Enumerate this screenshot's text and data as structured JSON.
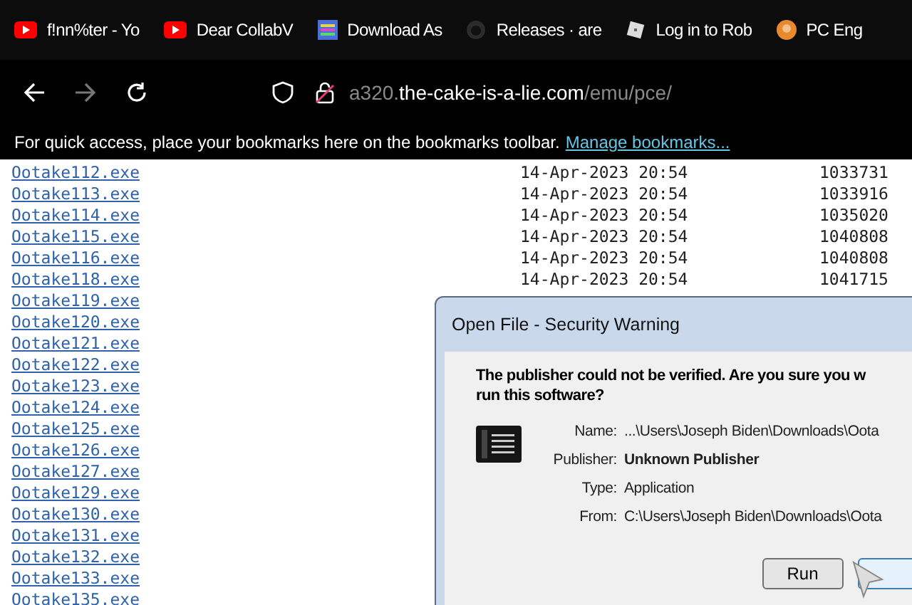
{
  "bookmark_tabs": [
    {
      "label": "f!nn%ter - Yo",
      "kind": "video"
    },
    {
      "label": "Dear CollabV",
      "kind": "video"
    },
    {
      "label": "Download As",
      "kind": "app"
    },
    {
      "label": "Releases · are",
      "kind": "code"
    },
    {
      "label": "Log in to Rob",
      "kind": "game"
    },
    {
      "label": "PC Eng",
      "kind": "orange"
    }
  ],
  "address_bar": {
    "host_prefix": "a320.",
    "domain": "the-cake-is-a-lie.com",
    "path": "/emu/pce/"
  },
  "bookmarks_bar": {
    "message": "For quick access, place your bookmarks here on the bookmarks toolbar.",
    "link": "Manage bookmarks..."
  },
  "listing": [
    {
      "name": "Ootake112.exe",
      "date": "14-Apr-2023 20:54",
      "size": "1033731"
    },
    {
      "name": "Ootake113.exe",
      "date": "14-Apr-2023 20:54",
      "size": "1033916"
    },
    {
      "name": "Ootake114.exe",
      "date": "14-Apr-2023 20:54",
      "size": "1035020"
    },
    {
      "name": "Ootake115.exe",
      "date": "14-Apr-2023 20:54",
      "size": "1040808"
    },
    {
      "name": "Ootake116.exe",
      "date": "14-Apr-2023 20:54",
      "size": "1040808"
    },
    {
      "name": "Ootake118.exe",
      "date": "14-Apr-2023 20:54",
      "size": "1041715"
    },
    {
      "name": "Ootake119.exe"
    },
    {
      "name": "Ootake120.exe"
    },
    {
      "name": "Ootake121.exe"
    },
    {
      "name": "Ootake122.exe"
    },
    {
      "name": "Ootake123.exe"
    },
    {
      "name": "Ootake124.exe"
    },
    {
      "name": "Ootake125.exe"
    },
    {
      "name": "Ootake126.exe"
    },
    {
      "name": "Ootake127.exe"
    },
    {
      "name": "Ootake129.exe"
    },
    {
      "name": "Ootake130.exe"
    },
    {
      "name": "Ootake131.exe"
    },
    {
      "name": "Ootake132.exe"
    },
    {
      "name": "Ootake133.exe"
    },
    {
      "name": "Ootake135.exe"
    }
  ],
  "dialog": {
    "title": "Open File - Security Warning",
    "heading": "The publisher could not be verified.  Are you sure you w",
    "heading_line2": "run this software?",
    "fields": [
      {
        "label": "Name:",
        "value": "...\\Users\\Joseph Biden\\Downloads\\Oota",
        "bold": false
      },
      {
        "label": "Publisher:",
        "value": "Unknown Publisher",
        "bold": true
      },
      {
        "label": "Type:",
        "value": "Application",
        "bold": false
      },
      {
        "label": "From:",
        "value": "C:\\Users\\Joseph Biden\\Downloads\\Oota",
        "bold": false
      }
    ],
    "run_button": "Run"
  }
}
